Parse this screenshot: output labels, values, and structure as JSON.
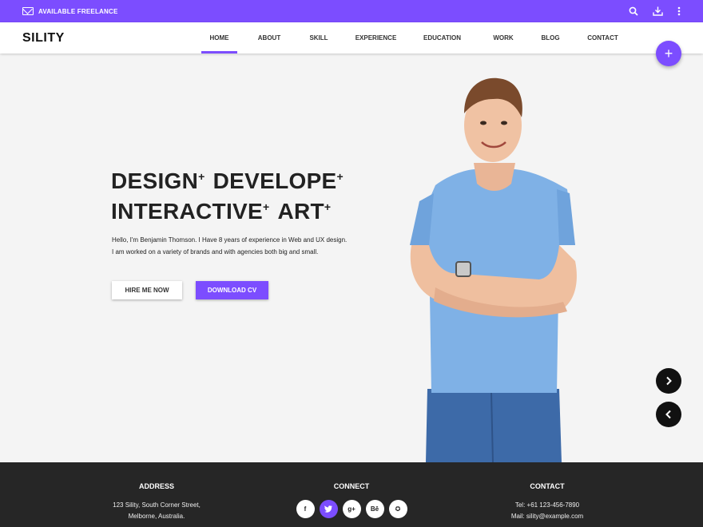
{
  "topbar": {
    "freelance_label": "AVAILABLE FREELANCE",
    "icons": [
      "mail-icon",
      "search-icon",
      "download-icon",
      "more-vert-icon"
    ]
  },
  "nav": {
    "logo": "SILITY",
    "items": [
      {
        "label": "HOME",
        "active": true
      },
      {
        "label": "ABOUT"
      },
      {
        "label": "SKILL"
      },
      {
        "label": "EXPERIENCE"
      },
      {
        "label": "EDUCATION"
      },
      {
        "label": "WORK"
      },
      {
        "label": "BLOG"
      },
      {
        "label": "CONTACT"
      }
    ]
  },
  "fab": {
    "label": "+"
  },
  "hero": {
    "line1": [
      "DESIGN",
      "DEVELOPE"
    ],
    "line2": [
      "INTERACTIVE",
      "ART"
    ],
    "plus": "+",
    "desc1": "Hello, I'm Benjamin Thomson. I Have 8 years of experience in Web and UX design.",
    "desc2": "I am worked on a variety of brands and with agencies both big and small.",
    "hire_label": "HIRE ME NOW",
    "cv_label": "DOWNLOAD CV"
  },
  "footer": {
    "address": {
      "title": "ADDRESS",
      "line1": "123 Sility, South Corner Street,",
      "line2": "Melborne, Australia."
    },
    "connect": {
      "title": "CONNECT",
      "social": [
        "f",
        "t",
        "g+",
        "Bē",
        "✪"
      ]
    },
    "contact": {
      "title": "CONTACT",
      "tel": "Tel: +61 123-456-7890",
      "mail": "Mail: sility@example.com"
    }
  },
  "colors": {
    "accent": "#7c4dff",
    "footer_bg": "#262626",
    "hero_bg": "#f4f4f4"
  }
}
